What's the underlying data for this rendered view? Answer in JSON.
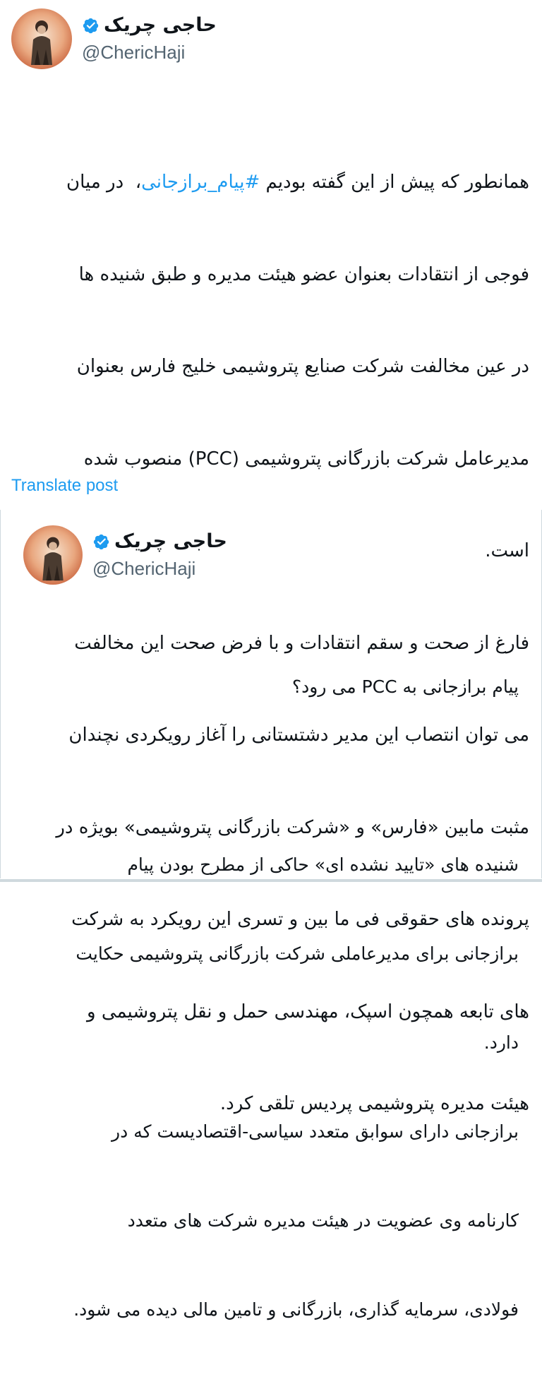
{
  "tweet": {
    "author": {
      "display_name": "حاجی چریک",
      "handle": "@ChericHaji",
      "avatar_icon": "avatar-portrait",
      "verified_icon": "verified-badge-icon",
      "verified_color": "#1d9bf0"
    },
    "body": {
      "p1_l1_pre": "همانطور که پیش از این گفته بودیم ",
      "p1_l1_hashtag": "#پیام_برازجانی",
      "p1_l1_post": "،  در میان",
      "p1_l2": "فوجی از انتقادات بعنوان عضو هیئت مدیره و طبق شنیده ها",
      "p1_l3": "در عین مخالفت شرکت صنایع پتروشیمی خلیج فارس بعنوان",
      "p1_l4": "مدیرعامل شرکت بازرگانی پتروشیمی (PCC) منصوب شده",
      "p1_l5": "است.",
      "p2_l1": "فارغ از صحت و سقم انتقادات و با فرض صحت این مخالفت",
      "p2_l2": "می توان انتصاب این مدیر دشتستانی را آغاز رویکردی نچندان",
      "p2_l3": "مثبت مابین «فارس» و «شرکت بازرگانی پتروشیمی» بویژه در",
      "p2_l4": "پرونده های حقوقی فی ما بین و تسری این رویکرد به شرکت",
      "p2_l5": "های تابعه همچون اسپک، مهندسی حمل و نقل پتروشیمی و",
      "p2_l6": "هیئت مدیره پتروشیمی پردیس تلقی کرد."
    },
    "translate_label": "Translate post",
    "link_color": "#1d9bf0"
  },
  "quoted_tweet": {
    "author": {
      "display_name": "حاجی چریک",
      "handle": "@ChericHaji",
      "avatar_icon": "avatar-portrait",
      "verified_icon": "verified-badge-icon"
    },
    "body": {
      "title": "پیام برازجانی به PCC می رود؟",
      "p1_l1": "شنیده های «تایید نشده ای» حاکی از مطرح بودن پیام",
      "p1_l2": "برازجانی برای مدیرعاملی شرکت بازرگانی پتروشیمی حکایت",
      "p1_l3": "دارد.",
      "p2_l1": "برازجانی دارای سوابق متعدد سیاسی-اقتصادیست که در",
      "p2_l2": "کارنامه وی عضویت در هیئت مدیره شرکت های متعدد",
      "p2_l3": "فولادی، سرمایه گذاری، بازرگانی و تامین مالی دیده می شود."
    }
  }
}
